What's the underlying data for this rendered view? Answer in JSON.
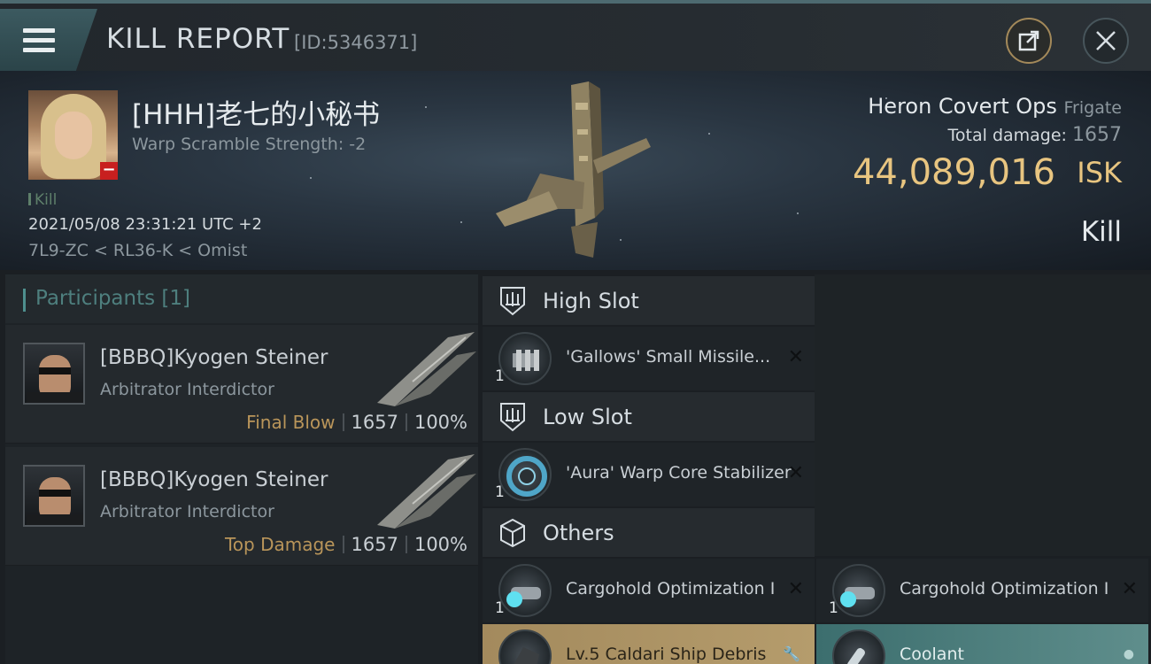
{
  "titlebar": {
    "title": "KILL REPORT",
    "report_id": "[ID:5346371]",
    "menu_icon": "hamburger-menu-icon",
    "share_icon": "external-share-icon",
    "close_icon": "close-icon"
  },
  "victim": {
    "name": "[HHH]老七的小秘书",
    "warp_scramble": "Warp Scramble Strength: -2",
    "kill_tag": "Kill",
    "datetime": "2021/05/08 23:31:21 UTC +2",
    "location": "7L9-ZC < RL36-K < Omist",
    "standing_badge": "−"
  },
  "ship": {
    "name": "Heron Covert Ops",
    "class": "Frigate",
    "total_damage_label": "Total damage:",
    "total_damage": "1657",
    "isk_value": "44,089,016",
    "isk_unit": "ISK",
    "result": "Kill"
  },
  "participants": {
    "label": "Participants [1]",
    "rows": [
      {
        "name": "[BBBQ]Kyogen Steiner",
        "ship": "Arbitrator Interdictor",
        "tag": "Final Blow",
        "damage": "1657",
        "percent": "100%"
      },
      {
        "name": "[BBBQ]Kyogen Steiner",
        "ship": "Arbitrator Interdictor",
        "tag": "Top Damage",
        "damage": "1657",
        "percent": "100%"
      }
    ]
  },
  "slots": {
    "high": {
      "label": "High Slot",
      "items": [
        {
          "qty": "1",
          "name": "'Gallows' Small Missile..."
        }
      ]
    },
    "low": {
      "label": "Low Slot",
      "items": [
        {
          "qty": "1",
          "name": "'Aura' Warp Core Stabilizer"
        }
      ]
    },
    "others": {
      "label": "Others",
      "items": [
        {
          "qty": "1",
          "name": "Cargohold Optimization I"
        },
        {
          "qty": "1",
          "name": "Cargohold Optimization I"
        },
        {
          "qty": "",
          "name": "Lv.5 Caldari Ship Debris"
        },
        {
          "qty": "",
          "name": "Coolant"
        }
      ]
    }
  },
  "colors": {
    "isk_gold": "#e8c580",
    "accent_teal": "#4e8f8e",
    "dropped_item": "#a38a5d",
    "destroyed_item": "#3c6e6e"
  }
}
